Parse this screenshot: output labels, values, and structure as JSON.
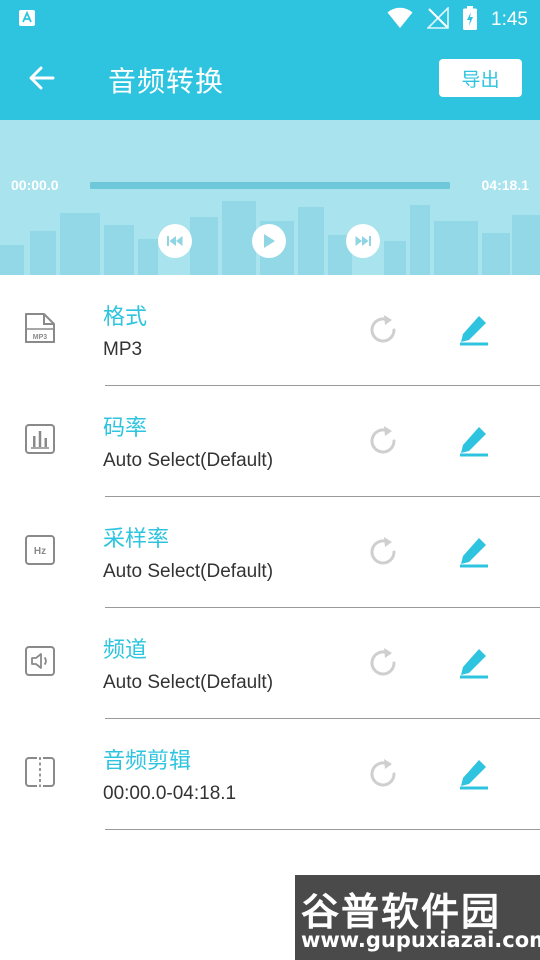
{
  "status_bar": {
    "time": "1:45",
    "icons": [
      "app-notification-icon",
      "wifi-icon",
      "no-signal-icon",
      "battery-charging-icon"
    ]
  },
  "toolbar": {
    "title": "音频转换",
    "export_label": "导出",
    "back_icon": "arrow-left-icon"
  },
  "player": {
    "time_start": "00:00.0",
    "time_end": "04:18.1",
    "progress": 0,
    "controls": [
      "skip-previous-icon",
      "play-icon",
      "skip-next-icon"
    ]
  },
  "settings": [
    {
      "label": "格式",
      "value": "MP3",
      "icon": "mp3-file-icon"
    },
    {
      "label": "码率",
      "value": "Auto Select(Default)",
      "icon": "bar-chart-icon"
    },
    {
      "label": "采样率",
      "value": "Auto Select(Default)",
      "icon": "hz-icon"
    },
    {
      "label": "频道",
      "value": "Auto Select(Default)",
      "icon": "speaker-icon"
    },
    {
      "label": "音频剪辑",
      "value": "00:00.0-04:18.1",
      "icon": "trim-icon"
    }
  ],
  "watermark": {
    "title": "谷普软件园",
    "url": "www.gupuxiazai.com"
  },
  "colors": {
    "accent": "#2ec4df",
    "player_bg": "#a8e3ee",
    "icon_gray": "#8a8a8a",
    "value_text": "#333333"
  }
}
